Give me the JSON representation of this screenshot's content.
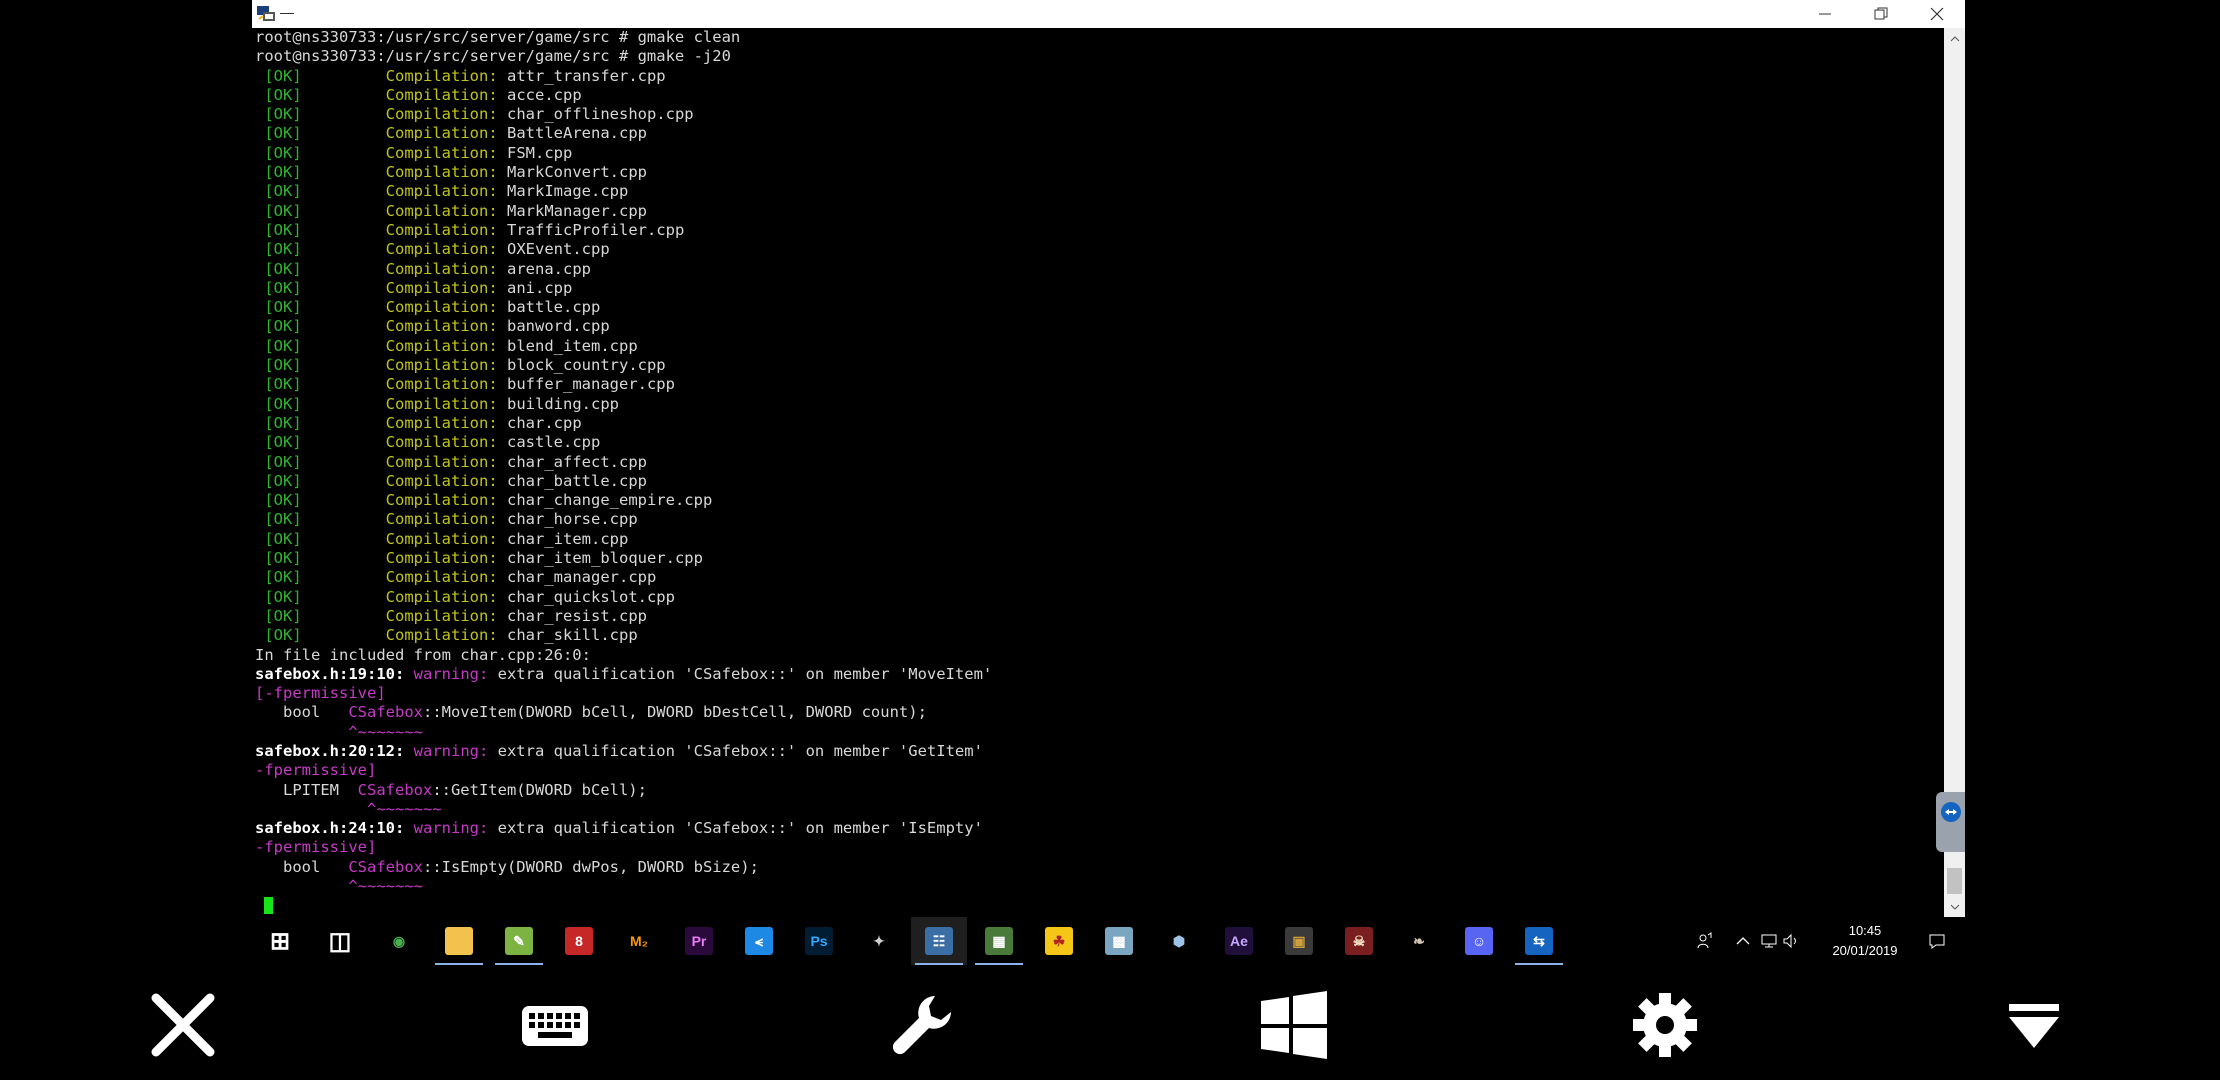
{
  "window": {
    "title": "—",
    "controls": {
      "minimize": "minimize",
      "maximize": "restore",
      "close": "close"
    }
  },
  "terminal": {
    "lines": [
      {
        "kind": "cmd",
        "text": "root@ns330733:/usr/src/server/game/src # gmake clean"
      },
      {
        "kind": "cmd",
        "text": "root@ns330733:/usr/src/server/game/src # gmake -j20"
      },
      {
        "kind": "ok",
        "status": "[OK]",
        "label": "Compilation:",
        "file": "attr_transfer.cpp"
      },
      {
        "kind": "ok",
        "status": "[OK]",
        "label": "Compilation:",
        "file": "acce.cpp"
      },
      {
        "kind": "ok",
        "status": "[OK]",
        "label": "Compilation:",
        "file": "char_offlineshop.cpp"
      },
      {
        "kind": "ok",
        "status": "[OK]",
        "label": "Compilation:",
        "file": "BattleArena.cpp"
      },
      {
        "kind": "ok",
        "status": "[OK]",
        "label": "Compilation:",
        "file": "FSM.cpp"
      },
      {
        "kind": "ok",
        "status": "[OK]",
        "label": "Compilation:",
        "file": "MarkConvert.cpp"
      },
      {
        "kind": "ok",
        "status": "[OK]",
        "label": "Compilation:",
        "file": "MarkImage.cpp"
      },
      {
        "kind": "ok",
        "status": "[OK]",
        "label": "Compilation:",
        "file": "MarkManager.cpp"
      },
      {
        "kind": "ok",
        "status": "[OK]",
        "label": "Compilation:",
        "file": "TrafficProfiler.cpp"
      },
      {
        "kind": "ok",
        "status": "[OK]",
        "label": "Compilation:",
        "file": "OXEvent.cpp"
      },
      {
        "kind": "ok",
        "status": "[OK]",
        "label": "Compilation:",
        "file": "arena.cpp"
      },
      {
        "kind": "ok",
        "status": "[OK]",
        "label": "Compilation:",
        "file": "ani.cpp"
      },
      {
        "kind": "ok",
        "status": "[OK]",
        "label": "Compilation:",
        "file": "battle.cpp"
      },
      {
        "kind": "ok",
        "status": "[OK]",
        "label": "Compilation:",
        "file": "banword.cpp"
      },
      {
        "kind": "ok",
        "status": "[OK]",
        "label": "Compilation:",
        "file": "blend_item.cpp"
      },
      {
        "kind": "ok",
        "status": "[OK]",
        "label": "Compilation:",
        "file": "block_country.cpp"
      },
      {
        "kind": "ok",
        "status": "[OK]",
        "label": "Compilation:",
        "file": "buffer_manager.cpp"
      },
      {
        "kind": "ok",
        "status": "[OK]",
        "label": "Compilation:",
        "file": "building.cpp"
      },
      {
        "kind": "ok",
        "status": "[OK]",
        "label": "Compilation:",
        "file": "char.cpp"
      },
      {
        "kind": "ok",
        "status": "[OK]",
        "label": "Compilation:",
        "file": "castle.cpp"
      },
      {
        "kind": "ok",
        "status": "[OK]",
        "label": "Compilation:",
        "file": "char_affect.cpp"
      },
      {
        "kind": "ok",
        "status": "[OK]",
        "label": "Compilation:",
        "file": "char_battle.cpp"
      },
      {
        "kind": "ok",
        "status": "[OK]",
        "label": "Compilation:",
        "file": "char_change_empire.cpp"
      },
      {
        "kind": "ok",
        "status": "[OK]",
        "label": "Compilation:",
        "file": "char_horse.cpp"
      },
      {
        "kind": "ok",
        "status": "[OK]",
        "label": "Compilation:",
        "file": "char_item.cpp"
      },
      {
        "kind": "ok",
        "status": "[OK]",
        "label": "Compilation:",
        "file": "char_item_bloquer.cpp"
      },
      {
        "kind": "ok",
        "status": "[OK]",
        "label": "Compilation:",
        "file": "char_manager.cpp"
      },
      {
        "kind": "ok",
        "status": "[OK]",
        "label": "Compilation:",
        "file": "char_quickslot.cpp"
      },
      {
        "kind": "ok",
        "status": "[OK]",
        "label": "Compilation:",
        "file": "char_resist.cpp"
      },
      {
        "kind": "ok",
        "status": "[OK]",
        "label": "Compilation:",
        "file": "char_skill.cpp"
      },
      {
        "kind": "plain",
        "text": "In file included from char.cpp:26:0:"
      },
      {
        "kind": "warn",
        "loc": "safebox.h:19:10:",
        "word": "warning:",
        "msg": " extra qualification 'CSafebox::' on member 'MoveItem'"
      },
      {
        "kind": "flag",
        "text": "[-fpermissive]"
      },
      {
        "kind": "code",
        "pre": "   bool   ",
        "cls": "CSafebox",
        "post": "::MoveItem(DWORD bCell, DWORD bDestCell, DWORD count);"
      },
      {
        "kind": "caret",
        "text": "          ^~~~~~~~"
      },
      {
        "kind": "warn",
        "loc": "safebox.h:20:12:",
        "word": "warning:",
        "msg": " extra qualification 'CSafebox::' on member 'GetItem'"
      },
      {
        "kind": "flag",
        "text": "-fpermissive]"
      },
      {
        "kind": "code",
        "pre": "   LPITEM  ",
        "cls": "CSafebox",
        "post": "::GetItem(DWORD bCell);"
      },
      {
        "kind": "caret",
        "text": "            ^~~~~~~~"
      },
      {
        "kind": "warn",
        "loc": "safebox.h:24:10:",
        "word": "warning:",
        "msg": " extra qualification 'CSafebox::' on member 'IsEmpty'"
      },
      {
        "kind": "flag",
        "text": "-fpermissive]"
      },
      {
        "kind": "code",
        "pre": "   bool   ",
        "cls": "CSafebox",
        "post": "::IsEmpty(DWORD dwPos, DWORD bSize);"
      },
      {
        "kind": "caret",
        "text": "          ^~~~~~~~"
      },
      {
        "kind": "cursor"
      }
    ]
  },
  "taskbar": {
    "items": [
      {
        "name": "start-button",
        "icon": "windows-icon",
        "symbol": "⊞",
        "bg": "transparent",
        "fg": "#ffffff"
      },
      {
        "name": "task-view-button",
        "icon": "task-view-icon",
        "symbol": "◫",
        "bg": "transparent",
        "fg": "#ffffff"
      },
      {
        "name": "chrome-app",
        "icon": "chrome-icon",
        "symbol": "◉",
        "bg": "transparent",
        "fg": "#4caf50"
      },
      {
        "name": "file-explorer-app",
        "icon": "folder-icon",
        "symbol": "▬",
        "bg": "#f2c14e",
        "fg": "#f2c14e",
        "running": true
      },
      {
        "name": "notepadpp-app",
        "icon": "notepad-icon",
        "symbol": "✎",
        "bg": "#7cb342",
        "fg": "#ffffff",
        "running": true
      },
      {
        "name": "red-app",
        "icon": "red-app-icon",
        "symbol": "8",
        "bg": "#c62828",
        "fg": "#ffffff"
      },
      {
        "name": "metin-app",
        "icon": "m2-icon",
        "symbol": "M₂",
        "bg": "transparent",
        "fg": "#ff9800"
      },
      {
        "name": "premiere-app",
        "icon": "premiere-pro-icon",
        "symbol": "Pr",
        "bg": "#2a0a3a",
        "fg": "#e77cf6"
      },
      {
        "name": "visual-studio-app",
        "icon": "visual-studio-icon",
        "symbol": "⪪",
        "bg": "#1e88e5",
        "fg": "#ffffff"
      },
      {
        "name": "photoshop-app",
        "icon": "photoshop-icon",
        "symbol": "Ps",
        "bg": "#001d34",
        "fg": "#31a8ff"
      },
      {
        "name": "wing-app",
        "icon": "wing-icon",
        "symbol": "✦",
        "bg": "transparent",
        "fg": "#cfcfcf"
      },
      {
        "name": "network-app",
        "icon": "network-icon",
        "symbol": "☷",
        "bg": "#3a6ea5",
        "fg": "#ffffff",
        "running": true,
        "active": true
      },
      {
        "name": "server-app",
        "icon": "server-icon",
        "symbol": "▦",
        "bg": "#4a7a3a",
        "fg": "#ffffff",
        "running": true
      },
      {
        "name": "filezilla-app",
        "icon": "filezilla-icon",
        "symbol": "☘",
        "bg": "#f5c518",
        "fg": "#b22222"
      },
      {
        "name": "image-app",
        "icon": "image-icon",
        "symbol": "▩",
        "bg": "#7aa6c2",
        "fg": "#ffffff"
      },
      {
        "name": "virtualbox-app",
        "icon": "virtualbox-icon",
        "symbol": "⬢",
        "bg": "transparent",
        "fg": "#9fc3e7"
      },
      {
        "name": "after-effects-app",
        "icon": "after-effects-icon",
        "symbol": "Ae",
        "bg": "#1f0f3a",
        "fg": "#c9a6ff"
      },
      {
        "name": "dark-app",
        "icon": "dark-app-icon",
        "symbol": "▣",
        "bg": "#3a3a3a",
        "fg": "#d0a040"
      },
      {
        "name": "game-app",
        "icon": "game-icon",
        "symbol": "☠",
        "bg": "#7a1f1f",
        "fg": "#f0e0c0"
      },
      {
        "name": "bird-app",
        "icon": "bird-icon",
        "symbol": "❧",
        "bg": "transparent",
        "fg": "#d8c8b8"
      },
      {
        "name": "discord-app",
        "icon": "discord-icon",
        "symbol": "☺",
        "bg": "#5865f2",
        "fg": "#ffffff"
      },
      {
        "name": "teamviewer-app",
        "icon": "teamviewer-icon",
        "symbol": "⇆",
        "bg": "#1565c0",
        "fg": "#ffffff",
        "running": true
      }
    ],
    "clock": {
      "time": "10:45",
      "date": "20/01/2019"
    }
  },
  "bottombar": {
    "buttons": [
      {
        "name": "close-session-button",
        "icon": "close-icon"
      },
      {
        "name": "keyboard-button",
        "icon": "keyboard-icon"
      },
      {
        "name": "tools-button",
        "icon": "wrench-icon"
      },
      {
        "name": "windows-key-button",
        "icon": "windows-icon"
      },
      {
        "name": "settings-button",
        "icon": "gear-icon"
      },
      {
        "name": "collapse-toolbar-button",
        "icon": "chevron-down-icon"
      }
    ]
  }
}
